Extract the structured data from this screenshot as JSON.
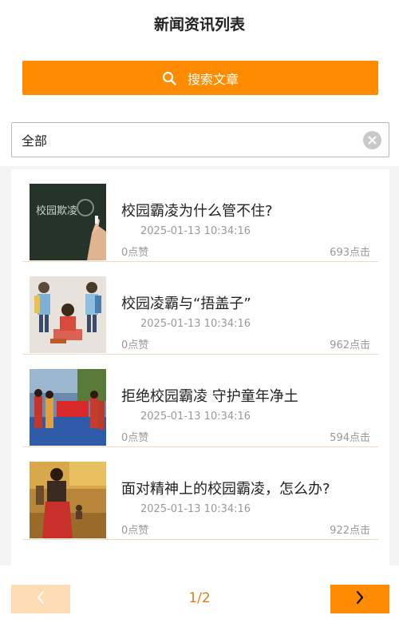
{
  "header": {
    "title": "新闻资讯列表"
  },
  "search": {
    "label": "搜索文章",
    "icon": "search-icon"
  },
  "filter": {
    "value": "全部",
    "icon": "clear-icon"
  },
  "news": [
    {
      "title": "校园霸凌为什么管不住?",
      "date": "2025-01-13 10:34:16",
      "likes": "0点赞",
      "clicks": "693点击",
      "image_text": "校园欺凌"
    },
    {
      "title": "校园凌霸与“捂盖子”",
      "date": "2025-01-13 10:34:16",
      "likes": "0点赞",
      "clicks": "962点击"
    },
    {
      "title": "拒绝校园霸凌 守护童年净土",
      "date": "2025-01-13 10:34:16",
      "likes": "0点赞",
      "clicks": "594点击"
    },
    {
      "title": "面对精神上的校园霸凌，怎么办?",
      "date": "2025-01-13 10:34:16",
      "likes": "0点赞",
      "clicks": "922点击"
    }
  ],
  "pagination": {
    "page": "1/2",
    "prev_icon": "chevron-left-icon",
    "next_icon": "chevron-right-icon"
  },
  "colors": {
    "accent": "#ff8c00",
    "accent_light": "#fedcb6",
    "divider": "#f5d9bf"
  }
}
